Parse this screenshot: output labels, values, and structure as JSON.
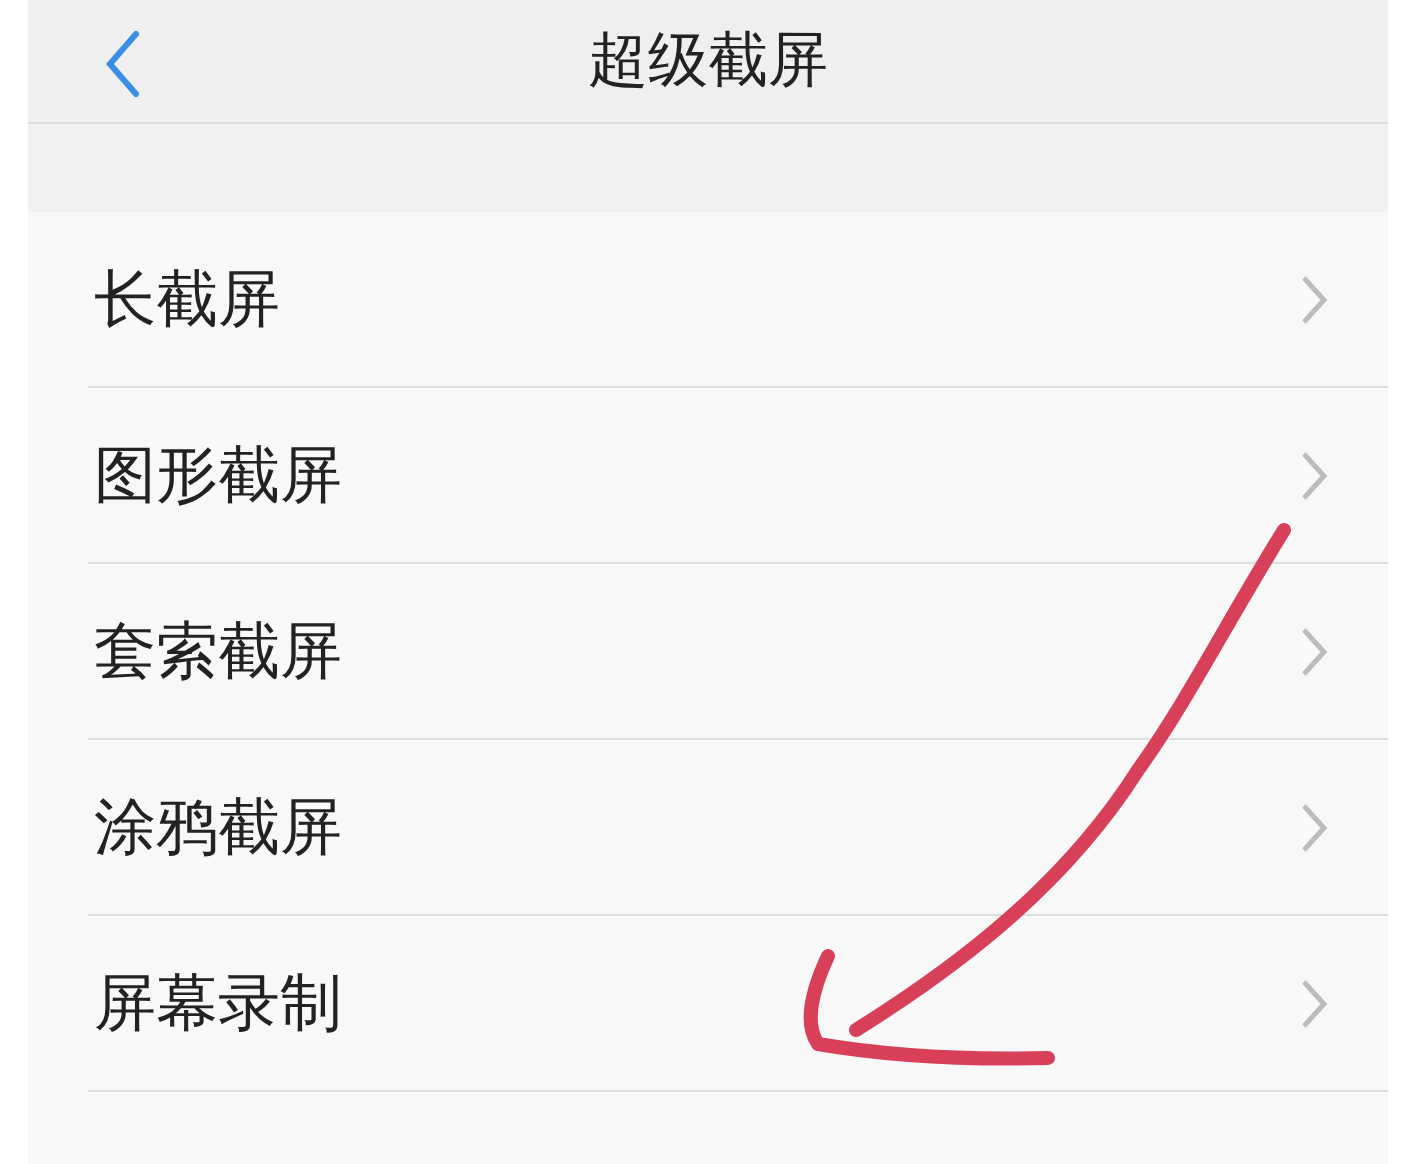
{
  "title": "超级截屏",
  "items": [
    {
      "label": "长截屏"
    },
    {
      "label": "图形截屏"
    },
    {
      "label": "套索截屏"
    },
    {
      "label": "涂鸦截屏"
    },
    {
      "label": "屏幕录制"
    }
  ]
}
